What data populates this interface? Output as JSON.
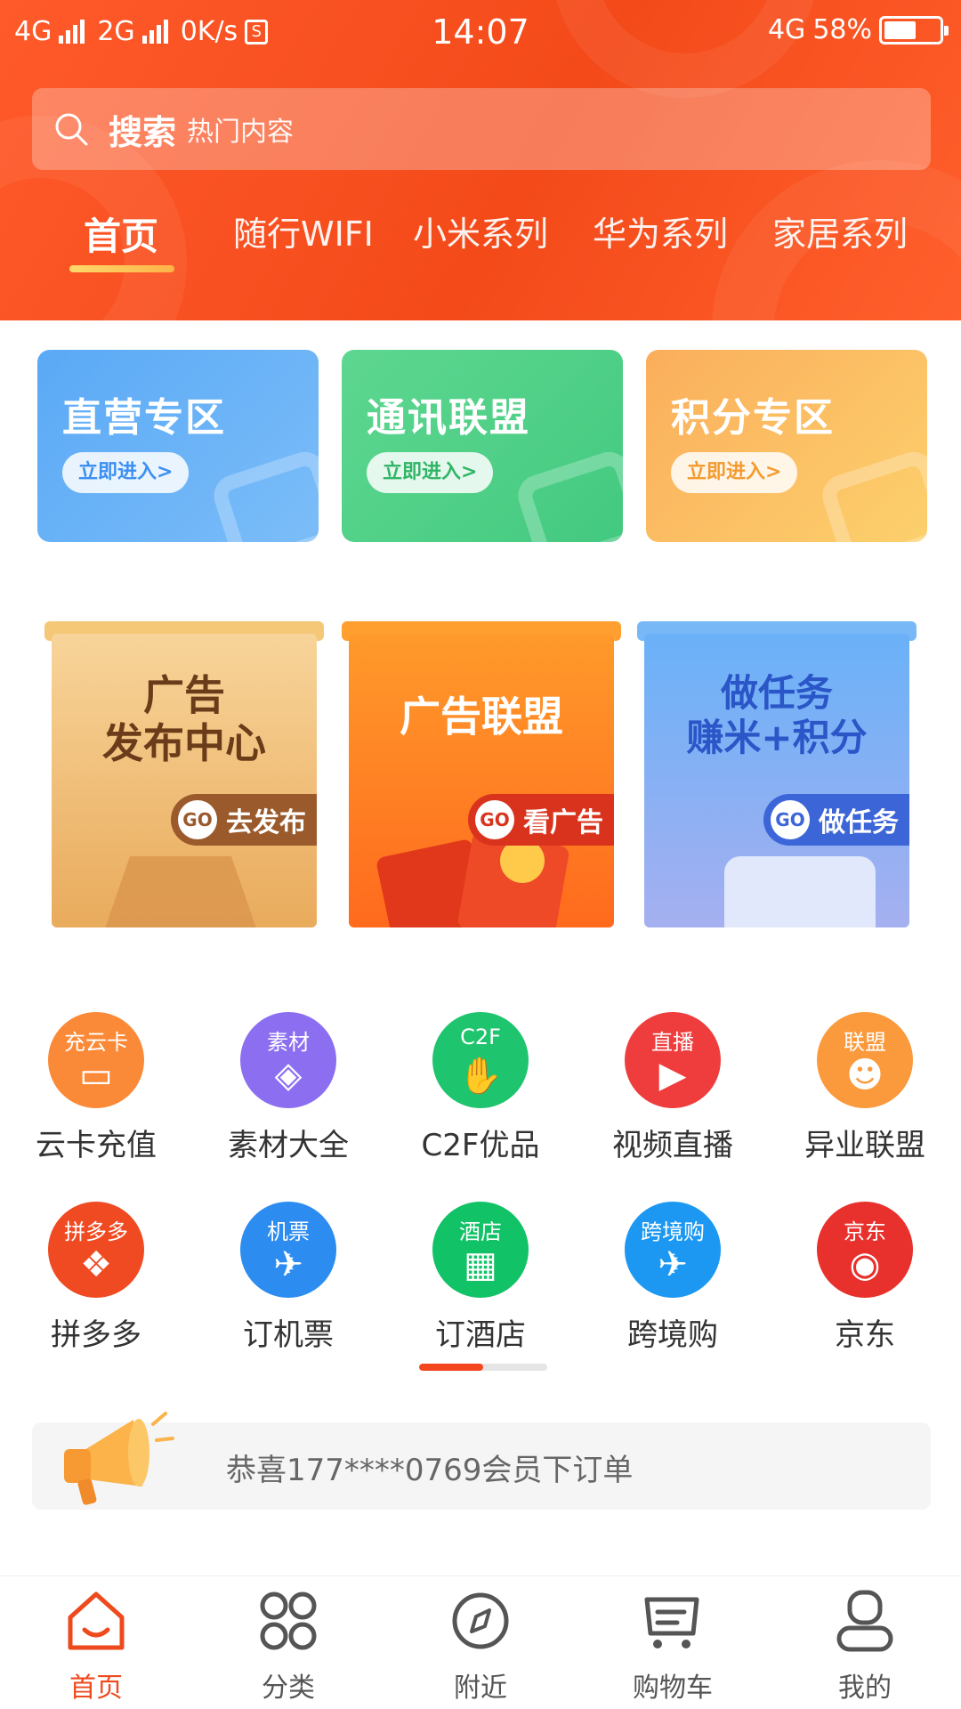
{
  "status_bar": {
    "network_left": "4G",
    "network_mid": "2G",
    "speed": "0K/s",
    "time": "14:07",
    "network_right": "4G",
    "battery": "58%",
    "battery_level": 0.58
  },
  "search": {
    "label": "搜索",
    "placeholder": "热门内容"
  },
  "tabs": [
    "首页",
    "随行WIFI",
    "小米系列",
    "华为系列",
    "家居系列"
  ],
  "active_tab": 0,
  "zones": [
    {
      "title": "直营专区",
      "button": "立即进入>"
    },
    {
      "title": "通讯联盟",
      "button": "立即进入>"
    },
    {
      "title": "积分专区",
      "button": "立即进入>"
    }
  ],
  "promos": [
    {
      "title_line1": "广告",
      "title_line2": "发布中心",
      "go": "GO",
      "action": "去发布"
    },
    {
      "title_line1": "广告联盟",
      "title_line2": "",
      "go": "GO",
      "action": "看广告"
    },
    {
      "title_line1": "做任务",
      "title_line2": "赚米+积分",
      "go": "GO",
      "action": "做任务"
    }
  ],
  "grid": [
    {
      "badge": "充云卡",
      "label": "云卡充值",
      "icon": "card-icon",
      "color": "#fb8a38"
    },
    {
      "badge": "素材",
      "label": "素材大全",
      "icon": "layers-icon",
      "color": "#8c6ff0"
    },
    {
      "badge": "C2F",
      "label": "C2F优品",
      "icon": "handshake-icon",
      "color": "#1fc46e"
    },
    {
      "badge": "直播",
      "label": "视频直播",
      "icon": "live-icon",
      "color": "#ef3d3d"
    },
    {
      "badge": "联盟",
      "label": "异业联盟",
      "icon": "people-icon",
      "color": "#fb9a3c"
    },
    {
      "badge": "拼多多",
      "label": "拼多多",
      "icon": "pinduoduo-icon",
      "color": "#f04a22"
    },
    {
      "badge": "机票",
      "label": "订机票",
      "icon": "plane-icon",
      "color": "#2d8cf0"
    },
    {
      "badge": "酒店",
      "label": "订酒店",
      "icon": "hotel-icon",
      "color": "#12c266"
    },
    {
      "badge": "跨境购",
      "label": "跨境购",
      "icon": "globe-icon",
      "color": "#1c98f2"
    },
    {
      "badge": "京东",
      "label": "京东",
      "icon": "jd-dog-icon",
      "color": "#e8302c"
    }
  ],
  "pager": {
    "page": 1,
    "pages": 2
  },
  "notice": {
    "text": "恭喜177****0769会员下订单"
  },
  "bottom_nav": [
    {
      "label": "首页",
      "icon": "home-icon",
      "active": true
    },
    {
      "label": "分类",
      "icon": "category-icon",
      "active": false
    },
    {
      "label": "附近",
      "icon": "compass-icon",
      "active": false
    },
    {
      "label": "购物车",
      "icon": "cart-icon",
      "active": false
    },
    {
      "label": "我的",
      "icon": "user-icon",
      "active": false
    }
  ],
  "colors": {
    "brand": "#f44a1a",
    "accent_underline": "#ffc65a",
    "nav_active": "#ee4a1e"
  }
}
